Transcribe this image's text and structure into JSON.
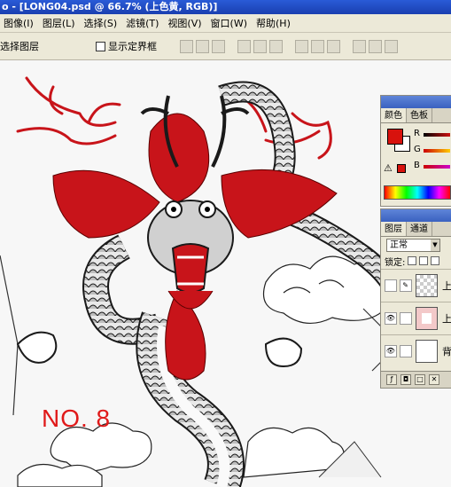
{
  "window": {
    "title": "o - [LONG04.psd @ 66.7% (上色黄, RGB)]"
  },
  "menu": [
    "图像(I)",
    "图层(L)",
    "选择(S)",
    "滤镜(T)",
    "视图(V)",
    "窗口(W)",
    "帮助(H)"
  ],
  "options_bar": {
    "auto_select_label": "选择图层",
    "show_bounds_label": "显示定界框",
    "show_bounds_checked": false
  },
  "canvas": {
    "watermark_text": "NO. 8",
    "watermark_color": "#e01a1a",
    "dragon_colors": {
      "red": "#c8141a",
      "ink": "#1a1a1a"
    }
  },
  "color_palette": {
    "tabs": [
      "颜色",
      "色板"
    ],
    "active_tab": "颜色",
    "channels": [
      "R",
      "G",
      "B"
    ],
    "foreground_color": "#d8120d",
    "background_color": "#ffffff",
    "warning_icon": "gamut-warning-icon"
  },
  "layers_palette": {
    "tabs": [
      "图层",
      "通道"
    ],
    "active_tab": "图层",
    "blend_mode": "正常",
    "lock_label": "锁定:",
    "layers": [
      {
        "name": "上",
        "visible": false,
        "selected": true
      },
      {
        "name": "上",
        "visible": true,
        "selected": false
      },
      {
        "name": "背",
        "visible": true,
        "selected": false
      }
    ]
  }
}
